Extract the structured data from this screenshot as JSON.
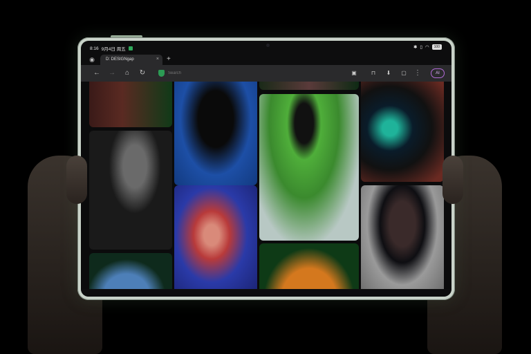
{
  "status_bar": {
    "time": "8:16",
    "date": "9月4日 周五",
    "battery": "100"
  },
  "tab_bar": {
    "tab_title": "D: DESIGNgap",
    "close_glyph": "×",
    "new_tab_glyph": "+"
  },
  "toolbar": {
    "address_placeholder": "Search",
    "ai_label": "AI",
    "icons": [
      "back-icon",
      "forward-icon",
      "home-icon",
      "reload-icon",
      "shield-icon",
      "reader-icon",
      "bookmark-icon",
      "download-icon",
      "tabs-icon",
      "menu-icon"
    ]
  },
  "colors": {
    "tablet_frame": "#c9d3c9",
    "toolbar": "#2a2a2c",
    "accent_ai": "#b46bd9",
    "shield": "#2c9a54"
  }
}
